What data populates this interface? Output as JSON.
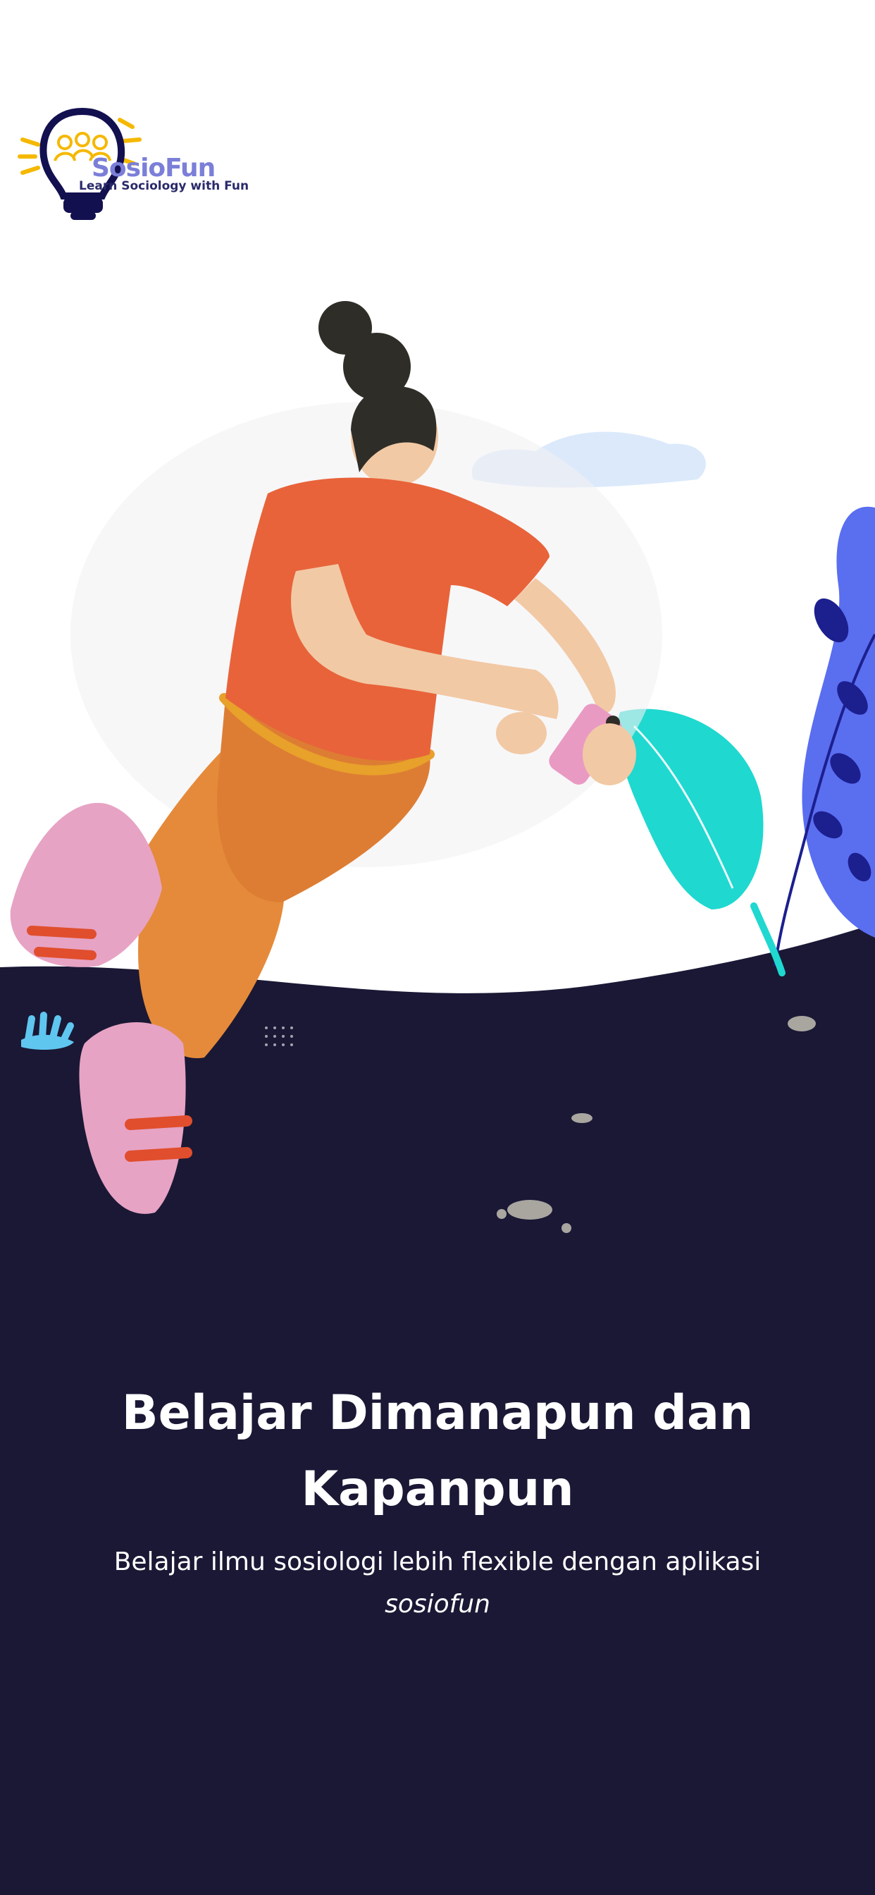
{
  "logo": {
    "name": "SosioFun",
    "tagline": "Learn Sociology with Fun",
    "icon": "lightbulb-people-icon"
  },
  "onboarding": {
    "title": "Belajar Dimanapun dan Kapanpun",
    "subtitle_text": "Belajar ilmu sosiologi lebih flexible dengan aplikasi",
    "subtitle_emphasis": "sosiofun"
  },
  "illustration": {
    "subject": "person-using-phone-illustration"
  },
  "colors": {
    "background": "#ffffff",
    "dark_panel": "#1a1835",
    "logo_yellow": "#f5b800",
    "logo_navy": "#131050",
    "logo_purple": "#7b7fd8",
    "shirt": "#e8633a",
    "pants": "#e58a3a",
    "shoes": "#e7a3c4",
    "leaf_teal": "#1fd8d0",
    "plant_blue": "#5a6ef0"
  }
}
